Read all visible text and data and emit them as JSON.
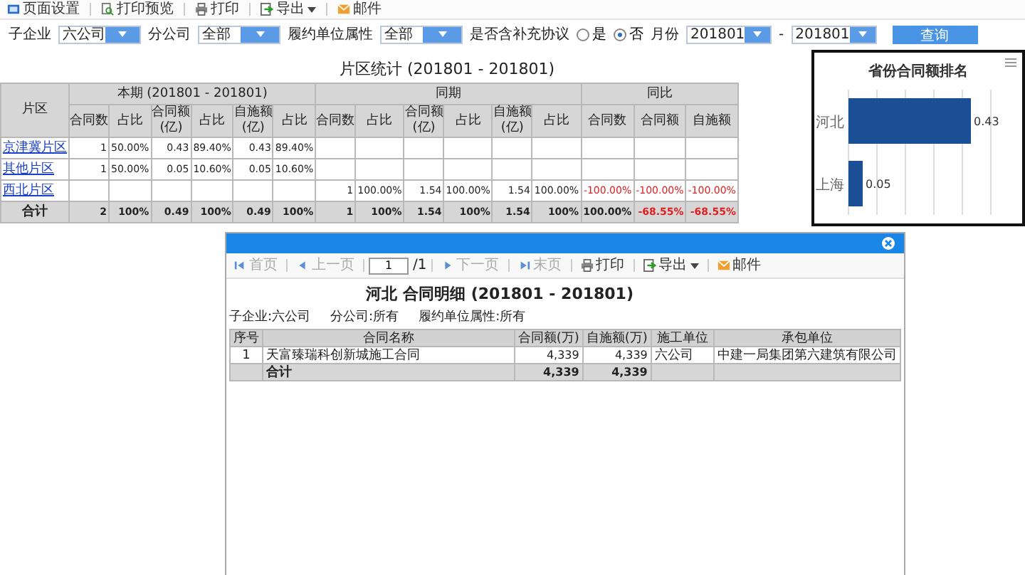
{
  "toolbar": [
    {
      "label": "页面设置",
      "kind": "setup",
      "dropdown": false
    },
    {
      "label": "打印预览",
      "kind": "preview",
      "dropdown": false
    },
    {
      "label": "打印",
      "kind": "print",
      "dropdown": false
    },
    {
      "label": "导出",
      "kind": "export",
      "dropdown": true
    },
    {
      "label": "邮件",
      "kind": "mail",
      "dropdown": false
    }
  ],
  "filters": {
    "company": {
      "label": "子企业",
      "value": "六公司"
    },
    "branch": {
      "label": "分公司",
      "value": "全部"
    },
    "unit_type": {
      "label": "履约单位属性",
      "value": "全部"
    },
    "supplement": {
      "label": "是否含补充协议",
      "options": [
        {
          "label": "是",
          "selected": false
        },
        {
          "label": "否",
          "selected": true
        }
      ]
    },
    "month": {
      "label": "月份",
      "from": "201801",
      "separator": "-",
      "to": "201801"
    },
    "query_button": "查询"
  },
  "report": {
    "title": "片区统计 (201801 - 201801)",
    "region_header": "片区",
    "groups": [
      {
        "label": "本期 (201801 - 201801)",
        "columns": [
          "合同数",
          "占比",
          "合同额\n(亿)",
          "占比",
          "自施额\n(亿)",
          "占比"
        ]
      },
      {
        "label": "同期",
        "columns": [
          "合同数",
          "占比",
          "合同额\n(亿)",
          "占比",
          "自施额\n(亿)",
          "占比"
        ]
      },
      {
        "label": "同比",
        "columns": [
          "合同数",
          "合同额",
          "自施额"
        ]
      }
    ],
    "rows": [
      {
        "kind": "region",
        "name": "京津冀片区",
        "current": [
          "1",
          "50.00%",
          "0.43",
          "89.40%",
          "0.43",
          "89.40%"
        ],
        "prior": [],
        "yoy": []
      },
      {
        "kind": "region",
        "name": "其他片区",
        "current": [
          "1",
          "50.00%",
          "0.05",
          "10.60%",
          "0.05",
          "10.60%"
        ],
        "prior": [],
        "yoy": []
      },
      {
        "kind": "region",
        "name": "西北片区",
        "current": [],
        "prior": [
          "1",
          "100.00%",
          "1.54",
          "100.00%",
          "1.54",
          "100.00%"
        ],
        "yoy": [
          {
            "text": "-100.00%",
            "negative": true
          },
          {
            "text": "-100.00%",
            "negative": true
          },
          {
            "text": "-100.00%",
            "negative": true
          }
        ]
      },
      {
        "kind": "total",
        "name": "合计",
        "current": [
          "2",
          "100%",
          "0.49",
          "100%",
          "0.49",
          "100%"
        ],
        "prior": [
          "1",
          "100%",
          "1.54",
          "100%",
          "1.54",
          "100%"
        ],
        "yoy": [
          {
            "text": "100.00%",
            "negative": false
          },
          {
            "text": "-68.55%",
            "negative": true
          },
          {
            "text": "-68.55%",
            "negative": true
          }
        ]
      }
    ]
  },
  "chart": {
    "chart_data": {
      "type": "bar",
      "orientation": "horizontal",
      "title": "省份合同额排名",
      "categories": [
        "河北",
        "上海"
      ],
      "series": [
        {
          "color": "#1a4f95",
          "values": [
            0.43,
            0.05
          ]
        }
      ],
      "data_labels": true,
      "value_labels": [
        "0.43",
        "0.05"
      ]
    }
  },
  "dialog": {
    "toolbar": [
      {
        "label": "首页",
        "kind": "first",
        "disabled": true,
        "dropdown": false
      },
      {
        "label": "上一页",
        "kind": "prev",
        "disabled": true,
        "dropdown": false
      },
      {
        "kind": "page",
        "value": "1",
        "total": "/1"
      },
      {
        "label": "下一页",
        "kind": "next",
        "disabled": true,
        "dropdown": false
      },
      {
        "label": "末页",
        "kind": "last",
        "disabled": true,
        "dropdown": false
      },
      {
        "label": "打印",
        "kind": "print",
        "disabled": false,
        "dropdown": false
      },
      {
        "label": "导出",
        "kind": "export",
        "disabled": false,
        "dropdown": true
      },
      {
        "label": "邮件",
        "kind": "mail",
        "disabled": false,
        "dropdown": false
      }
    ],
    "title": "河北 合同明细 (201801 - 201801)",
    "filters": [
      "子企业:六公司",
      "分公司:所有",
      "履约单位属性:所有"
    ],
    "columns": [
      "序号",
      "合同名称",
      "合同额(万)",
      "自施额(万)",
      "施工单位",
      "承包单位"
    ],
    "rows": [
      {
        "kind": "item",
        "cells": [
          "1",
          "天富臻瑞科创新城施工合同",
          "4,339",
          "4,339",
          "六公司",
          "中建一局集团第六建筑有限公司"
        ]
      },
      {
        "kind": "total",
        "cells": [
          "",
          "合计",
          "4,339",
          "4,339",
          "",
          ""
        ]
      }
    ]
  }
}
